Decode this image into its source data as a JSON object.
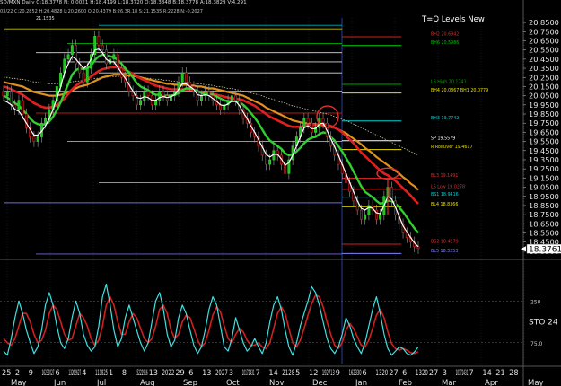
{
  "header": {
    "symbol_line": "SD/MXN Daily  C:18.3778  N: 0.0021  H:18.4199  L:18.3720  O:18.3848  B:18.3778  A:18.3829  V:4,291",
    "indicator_line": "03/22  C:20.2852  H:20.4828  L:20.2600  O:20.4379  B:26.3R.18  S:21.1535  R:2228  N:-0.2027",
    "top_level": "21.1535"
  },
  "chart_title": "T=Q Levels New",
  "chart_data": [
    {
      "type": "line",
      "title": "T=Q Levels New",
      "y_ticks": [
        "20.8500",
        "20.7500",
        "20.6500",
        "20.5500",
        "20.4500",
        "20.3500",
        "20.2500",
        "20.1500",
        "20.0500",
        "19.9500",
        "19.8500",
        "19.7500",
        "19.6500",
        "19.5500",
        "19.4500",
        "19.3500",
        "19.2500",
        "19.1500",
        "19.0500",
        "18.9500",
        "18.8500",
        "18.7500",
        "18.6500",
        "18.5500",
        "18.4500",
        "18.3500"
      ],
      "y_tick_labels": [
        "20.8500",
        "20.7500",
        "20.6500",
        "20.5500",
        "20.4500",
        "20.3500",
        "20.2500",
        "20.1500",
        "20.0500",
        "19.9500",
        "19.8500",
        "19.7500",
        "19.6500",
        "19.5500",
        "19.4500",
        "19.3500",
        "19.2500",
        "19.1500",
        "19.0500",
        "18.9500",
        "18.8500",
        "18.7500",
        "18.6500",
        "18.5500",
        "18.4500",
        "18.3500"
      ],
      "ylim": [
        18.3,
        20.9
      ],
      "last_price": "18.3761",
      "series": [],
      "close": [
        20.05,
        20.1,
        19.95,
        19.9,
        20.0,
        19.85,
        19.7,
        19.6,
        19.55,
        19.6,
        19.75,
        19.8,
        19.9,
        20.0,
        20.15,
        20.3,
        20.45,
        20.5,
        20.6,
        20.4,
        20.3,
        20.2,
        20.35,
        20.5,
        20.7,
        20.6,
        20.55,
        20.4,
        20.45,
        20.5,
        20.35,
        20.25,
        20.2,
        20.1,
        20.05,
        19.95,
        20.0,
        20.1,
        20.05,
        19.95,
        20.0,
        20.1,
        20.05,
        20.0,
        20.05,
        20.1,
        20.2,
        20.3,
        20.2,
        20.15,
        20.1,
        20.0,
        20.05,
        20.1,
        20.05,
        20.0,
        19.95,
        19.9,
        19.95,
        20.0,
        20.05,
        20.0,
        19.9,
        19.8,
        19.75,
        19.65,
        19.6,
        19.5,
        19.4,
        19.3,
        19.35,
        19.45,
        19.4,
        19.3,
        19.2,
        19.35,
        19.5,
        19.6,
        19.7,
        19.8,
        19.75,
        19.65,
        19.7,
        19.8,
        19.75,
        19.6,
        19.5,
        19.4,
        19.3,
        19.2,
        19.1,
        19.0,
        18.9,
        18.8,
        18.7,
        18.75,
        18.85,
        18.8,
        18.7,
        18.75,
        18.95,
        19.05,
        18.9,
        18.75,
        18.65,
        18.55,
        18.5,
        18.45,
        18.4,
        18.38
      ],
      "ma_white": [
        20.0,
        19.98,
        19.95,
        19.9,
        19.88,
        19.82,
        19.75,
        19.68,
        19.62,
        19.62,
        19.66,
        19.72,
        19.8,
        19.9,
        20.02,
        20.15,
        20.3,
        20.4,
        20.48,
        20.45,
        20.4,
        20.35,
        20.38,
        20.45,
        20.55,
        20.56,
        20.52,
        20.45,
        20.42,
        20.42,
        20.36,
        20.3,
        20.24,
        20.17,
        20.1,
        20.03,
        20.02,
        20.04,
        20.03,
        20.0,
        20.0,
        20.03,
        20.04,
        20.03,
        20.04,
        20.06,
        20.12,
        20.18,
        20.18,
        20.15,
        20.12,
        20.06,
        20.05,
        20.06,
        20.05,
        20.02,
        19.99,
        19.95,
        19.94,
        19.96,
        19.99,
        19.99,
        19.94,
        19.87,
        19.8,
        19.72,
        19.65,
        19.57,
        19.49,
        19.41,
        19.38,
        19.41,
        19.41,
        19.36,
        19.29,
        19.32,
        19.4,
        19.5,
        19.6,
        19.7,
        19.72,
        19.69,
        19.69,
        19.74,
        19.75,
        19.67,
        19.58,
        19.49,
        19.4,
        19.3,
        19.2,
        19.1,
        19.0,
        18.9,
        18.82,
        18.8,
        18.83,
        18.82,
        18.77,
        18.76,
        18.85,
        18.95,
        18.92,
        18.83,
        18.73,
        18.63,
        18.56,
        18.5,
        18.44,
        18.4
      ],
      "ma_green": [
        20.05,
        20.03,
        20.0,
        19.97,
        19.94,
        19.9,
        19.85,
        19.8,
        19.76,
        19.74,
        19.73,
        19.74,
        19.77,
        19.82,
        19.89,
        19.98,
        20.08,
        20.18,
        20.28,
        20.33,
        20.35,
        20.34,
        20.35,
        20.38,
        20.44,
        20.48,
        20.5,
        20.49,
        20.48,
        20.47,
        20.44,
        20.4,
        20.35,
        20.3,
        20.25,
        20.19,
        20.15,
        20.13,
        20.11,
        20.08,
        20.06,
        20.06,
        20.05,
        20.05,
        20.05,
        20.06,
        20.08,
        20.11,
        20.13,
        20.13,
        20.12,
        20.1,
        20.08,
        20.07,
        20.07,
        20.06,
        20.04,
        20.02,
        20.0,
        19.99,
        19.99,
        19.99,
        19.98,
        19.95,
        19.91,
        19.86,
        19.81,
        19.75,
        19.68,
        19.61,
        19.56,
        19.53,
        19.5,
        19.47,
        19.42,
        19.4,
        19.41,
        19.44,
        19.48,
        19.53,
        19.57,
        19.59,
        19.6,
        19.63,
        19.65,
        19.64,
        19.6,
        19.56,
        19.5,
        19.44,
        19.37,
        19.3,
        19.22,
        19.14,
        19.06,
        19.0,
        18.97,
        18.94,
        18.9,
        18.87,
        18.88,
        18.9,
        18.9,
        18.87,
        18.83,
        18.78,
        18.72,
        18.66,
        18.6,
        18.55
      ],
      "ma_red": [
        20.15,
        20.14,
        20.12,
        20.1,
        20.08,
        20.06,
        20.03,
        20.0,
        19.97,
        19.95,
        19.93,
        19.92,
        19.92,
        19.93,
        19.95,
        19.98,
        20.02,
        20.07,
        20.12,
        20.16,
        20.19,
        20.21,
        20.23,
        20.26,
        20.29,
        20.32,
        20.34,
        20.35,
        20.36,
        20.36,
        20.36,
        20.35,
        20.33,
        20.31,
        20.29,
        20.26,
        20.24,
        20.22,
        20.2,
        20.18,
        20.16,
        20.15,
        20.14,
        20.13,
        20.12,
        20.12,
        20.12,
        20.12,
        20.12,
        20.12,
        20.11,
        20.1,
        20.09,
        20.08,
        20.08,
        20.07,
        20.06,
        20.05,
        20.04,
        20.03,
        20.02,
        20.02,
        20.01,
        20.0,
        19.98,
        19.96,
        19.94,
        19.91,
        19.88,
        19.85,
        19.82,
        19.8,
        19.78,
        19.76,
        19.74,
        19.72,
        19.71,
        19.71,
        19.71,
        19.72,
        19.73,
        19.73,
        19.73,
        19.74,
        19.74,
        19.73,
        19.72,
        19.7,
        19.68,
        19.65,
        19.61,
        19.57,
        19.53,
        19.48,
        19.43,
        19.39,
        19.35,
        19.31,
        19.27,
        19.23,
        19.2,
        19.18,
        19.15,
        19.12,
        19.08,
        19.04,
        19.0,
        18.96,
        18.91,
        18.87
      ],
      "ma_orange": [
        20.2,
        20.19,
        20.18,
        20.17,
        20.16,
        20.15,
        20.13,
        20.11,
        20.09,
        20.08,
        20.07,
        20.06,
        20.05,
        20.05,
        20.05,
        20.06,
        20.07,
        20.09,
        20.11,
        20.13,
        20.15,
        20.16,
        20.17,
        20.19,
        20.21,
        20.23,
        20.25,
        20.26,
        20.27,
        20.28,
        20.28,
        20.28,
        20.28,
        20.27,
        20.27,
        20.26,
        20.25,
        20.24,
        20.23,
        20.22,
        20.21,
        20.2,
        20.19,
        20.18,
        20.18,
        20.17,
        20.17,
        20.17,
        20.17,
        20.16,
        20.16,
        20.15,
        20.15,
        20.14,
        20.13,
        20.13,
        20.12,
        20.11,
        20.1,
        20.09,
        20.08,
        20.07,
        20.06,
        20.05,
        20.03,
        20.01,
        19.99,
        19.97,
        19.95,
        19.92,
        19.9,
        19.88,
        19.86,
        19.84,
        19.82,
        19.8,
        19.78,
        19.77,
        19.76,
        19.75,
        19.75,
        19.74,
        19.74,
        19.73,
        19.73,
        19.72,
        19.71,
        19.7,
        19.68,
        19.66,
        19.64,
        19.61,
        19.58,
        19.55,
        19.52,
        19.48,
        19.45,
        19.42,
        19.38,
        19.35,
        19.32,
        19.29,
        19.26,
        19.23,
        19.2,
        19.16,
        19.13,
        19.09,
        19.06,
        19.02
      ],
      "ma_dotted": [
        20.25,
        20.25,
        20.24,
        20.24,
        20.23,
        20.23,
        20.22,
        20.21,
        20.2,
        20.2,
        20.19,
        20.19,
        20.18,
        20.18,
        20.18,
        20.18,
        20.19,
        20.19,
        20.2,
        20.21,
        20.21,
        20.22,
        20.22,
        20.23,
        20.24,
        20.24,
        20.25,
        20.25,
        20.26,
        20.26,
        20.26,
        20.26,
        20.26,
        20.26,
        20.26,
        20.25,
        20.25,
        20.25,
        20.24,
        20.24,
        20.23,
        20.23,
        20.22,
        20.22,
        20.21,
        20.21,
        20.2,
        20.2,
        20.2,
        20.19,
        20.19,
        20.18,
        20.18,
        20.17,
        20.17,
        20.16,
        20.15,
        20.15,
        20.14,
        20.13,
        20.13,
        20.12,
        20.11,
        20.1,
        20.09,
        20.08,
        20.07,
        20.06,
        20.05,
        20.03,
        20.02,
        20.01,
        19.99,
        19.98,
        19.97,
        19.95,
        19.94,
        19.93,
        19.92,
        19.91,
        19.9,
        19.89,
        19.88,
        19.87,
        19.86,
        19.85,
        19.84,
        19.82,
        19.81,
        19.79,
        19.78,
        19.76,
        19.74,
        19.72,
        19.7,
        19.68,
        19.66,
        19.64,
        19.62,
        19.6,
        19.58,
        19.56,
        19.54,
        19.52,
        19.5,
        19.48,
        19.46,
        19.44,
        19.42,
        19.4
      ],
      "levels": [
        {
          "label": "BH6 20.5986",
          "value": 20.5986,
          "color": "#00d000",
          "text_color": "#00c000",
          "x0": 0.61,
          "x1": 0.76
        },
        {
          "label": "BH2 20.6942",
          "value": 20.6942,
          "color": "#d02020",
          "text_color": "#d03030",
          "x0": 0.61,
          "x1": 0.76
        },
        {
          "label": "LS High 20.1741",
          "value": 20.1741,
          "color": "#00a000",
          "text_color": "#00a000",
          "x0": 0.61,
          "x1": 0.76
        },
        {
          "label": "BH4 20.0867  BH1 20.0779",
          "value": 20.08,
          "color": "#e8e000",
          "text_color": "#e8e000",
          "x0": 0.61,
          "x1": 0.76
        },
        {
          "label": "BH3 19.7742",
          "value": 19.7742,
          "color": "#00d0d0",
          "text_color": "#00d0d0",
          "x0": 0.61,
          "x1": 0.76
        },
        {
          "label": "SP 19.5579",
          "value": 19.5579,
          "color": "#ffffff",
          "text_color": "#ffffff",
          "x0": 0.61,
          "x1": 0.76
        },
        {
          "label": "R RollOver 19.4617",
          "value": 19.4617,
          "color": "#e8e000",
          "text_color": "#e8e000",
          "x0": 0.61,
          "x1": 0.76
        },
        {
          "label": "BL3 19.1491",
          "value": 19.1491,
          "color": "#d02020",
          "text_color": "#d03030",
          "x0": 0.61,
          "x1": 0.76
        },
        {
          "label": "LS Low 19.0278",
          "value": 19.0278,
          "color": "#d02020",
          "text_color": "#d03030",
          "x0": 0.61,
          "x1": 0.76
        },
        {
          "label": "BS1 18.9416",
          "value": 18.9416,
          "color": "#00d0d0",
          "text_color": "#00d0d0",
          "x0": 0.61,
          "x1": 0.76
        },
        {
          "label": "BL4 18.8366",
          "value": 18.8366,
          "color": "#e8e000",
          "text_color": "#e8e000",
          "x0": 0.61,
          "x1": 0.76
        },
        {
          "label": "BS2 18.4279",
          "value": 18.4279,
          "color": "#d02020",
          "text_color": "#d03030",
          "x0": 0.61,
          "x1": 0.76
        },
        {
          "label": "BL5 18.3253",
          "value": 18.3253,
          "color": "#8080ff",
          "text_color": "#8080ff",
          "x0": 0.61,
          "x1": 0.76
        }
      ],
      "x_tick_labels": [
        "25",
        "2",
        "9",
        "16232027",
        "6",
        "13202627",
        "4",
        "111825",
        "1",
        "8",
        "15222916",
        "13",
        "2022",
        "29",
        "6",
        "13",
        "2027",
        "3",
        "10172431",
        "7",
        "14",
        "2128",
        "5",
        "12",
        "192713",
        "9",
        "162330",
        "6",
        "1320",
        "27",
        "6",
        "1320",
        "27",
        "3",
        "10172431",
        "7",
        "14",
        "21",
        "28"
      ],
      "month_labels": [
        "May",
        "Jun",
        "Jul",
        "Aug",
        "Sep",
        "Oct",
        "Nov",
        "Dec",
        "Jan",
        "Feb",
        "Mar",
        "Apr",
        "May"
      ]
    },
    {
      "type": "line",
      "title": "STO",
      "indicator_label": "STO  24",
      "ylim": [
        0,
        100
      ],
      "y_ticks": [
        75,
        25
      ],
      "y_tick_labels": [
        "250",
        "75.0"
      ],
      "series": [
        {
          "name": "%K",
          "color": "#40e0e0",
          "values": [
            15,
            10,
            30,
            55,
            75,
            60,
            40,
            25,
            12,
            20,
            40,
            70,
            85,
            70,
            45,
            25,
            18,
            30,
            55,
            75,
            60,
            35,
            22,
            15,
            20,
            45,
            80,
            95,
            70,
            40,
            20,
            30,
            55,
            70,
            55,
            40,
            25,
            15,
            25,
            50,
            75,
            85,
            65,
            35,
            20,
            28,
            55,
            70,
            60,
            40,
            22,
            12,
            20,
            40,
            65,
            80,
            70,
            45,
            20,
            15,
            30,
            55,
            40,
            25,
            15,
            20,
            30,
            20,
            12,
            25,
            50,
            70,
            80,
            65,
            40,
            20,
            10,
            25,
            45,
            60,
            75,
            92,
            85,
            70,
            50,
            30,
            18,
            12,
            20,
            35,
            55,
            45,
            30,
            20,
            12,
            25,
            45,
            65,
            80,
            60,
            35,
            18,
            10,
            15,
            20,
            18,
            12,
            10,
            14,
            20
          ]
        },
        {
          "name": "%D",
          "color": "#d02020",
          "values": [
            30,
            25,
            22,
            30,
            45,
            60,
            60,
            50,
            35,
            25,
            28,
            40,
            60,
            70,
            65,
            50,
            35,
            28,
            30,
            45,
            60,
            55,
            45,
            30,
            22,
            28,
            45,
            70,
            80,
            70,
            50,
            35,
            35,
            50,
            60,
            55,
            42,
            30,
            25,
            30,
            45,
            65,
            70,
            60,
            40,
            30,
            35,
            50,
            58,
            55,
            42,
            28,
            20,
            25,
            40,
            58,
            68,
            62,
            45,
            30,
            25,
            35,
            42,
            38,
            28,
            22,
            22,
            25,
            20,
            18,
            25,
            42,
            60,
            68,
            60,
            42,
            25,
            20,
            28,
            42,
            58,
            72,
            82,
            80,
            68,
            50,
            35,
            22,
            18,
            25,
            40,
            48,
            42,
            32,
            22,
            20,
            28,
            42,
            58,
            65,
            55,
            38,
            24,
            18,
            16,
            18,
            16,
            13,
            12,
            14
          ]
        }
      ]
    }
  ]
}
